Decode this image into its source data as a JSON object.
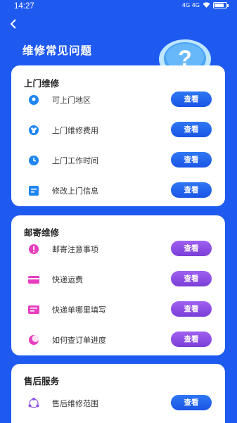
{
  "statusbar": {
    "time": "14:27",
    "network": "4G 4G"
  },
  "header": {
    "back_icon": "chevron-left-icon",
    "title": "维修常见问题"
  },
  "sections": [
    {
      "title": "上门维修",
      "items": [
        {
          "label": "可上门地区",
          "button": "查看",
          "icon": "location-icon"
        },
        {
          "label": "上门维修费用",
          "button": "查看",
          "icon": "tshirt-icon"
        },
        {
          "label": "上门工作时间",
          "button": "查看",
          "icon": "clock-icon"
        },
        {
          "label": "修改上门信息",
          "button": "查看",
          "icon": "edit-icon"
        }
      ]
    },
    {
      "title": "邮寄维修",
      "items": [
        {
          "label": "邮寄注意事项",
          "button": "查看",
          "icon": "alert-icon"
        },
        {
          "label": "快递运费",
          "button": "查看",
          "icon": "card-icon"
        },
        {
          "label": "快递单哪里填写",
          "button": "查看",
          "icon": "form-icon"
        },
        {
          "label": "如何查订单进度",
          "button": "查看",
          "icon": "moon-icon"
        }
      ]
    },
    {
      "title": "售后服务",
      "items": [
        {
          "label": "售后维修范围",
          "button": "查看",
          "icon": "network-icon"
        }
      ]
    }
  ],
  "colors": {
    "background": "#1f5af0",
    "blue_button": "#2a6cf2",
    "purple_button": "#8e4fe6"
  }
}
